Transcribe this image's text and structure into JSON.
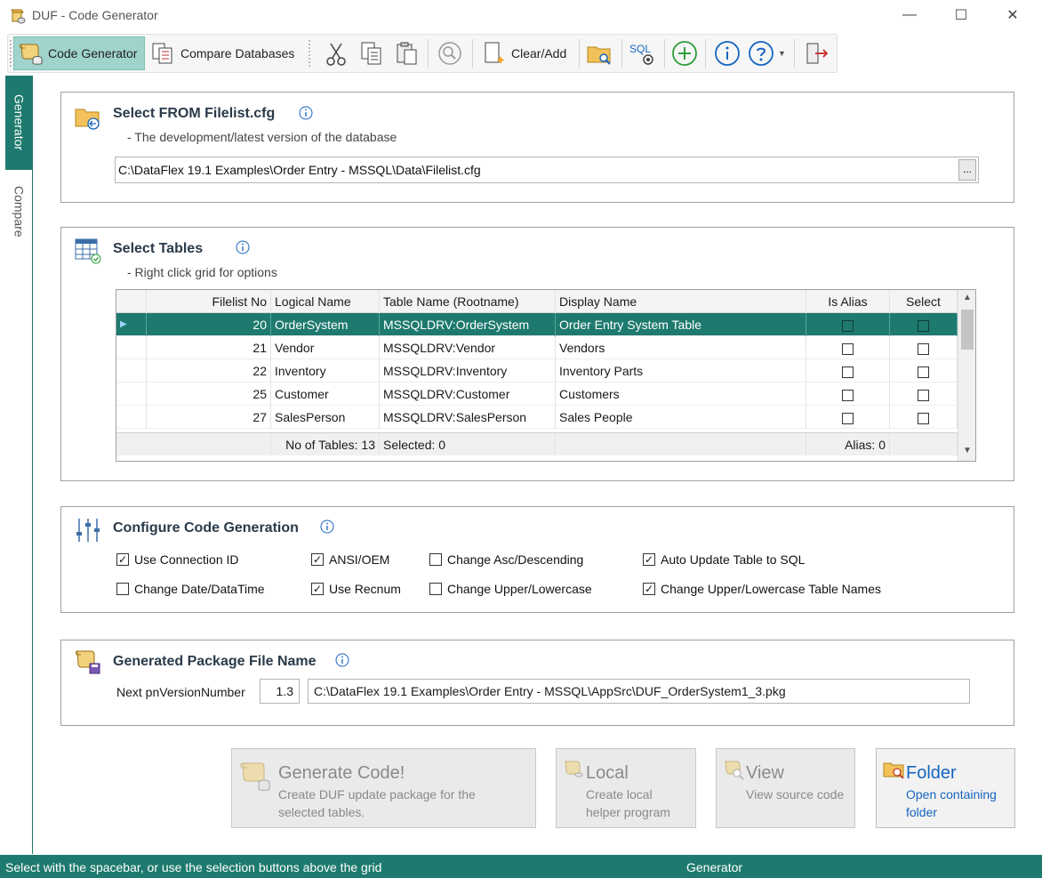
{
  "window": {
    "title": "DUF - Code Generator",
    "minimize": "—",
    "maximize": "☐",
    "close": "✕"
  },
  "toolbar": {
    "code_generator": "Code Generator",
    "compare_databases": "Compare Databases",
    "clear_add": "Clear/Add",
    "sql": "SQL"
  },
  "sidetabs": {
    "generator": "Generator",
    "compare": "Compare"
  },
  "select_from": {
    "title": "Select FROM Filelist.cfg",
    "subtitle": "- The development/latest version of the database",
    "path": "C:\\DataFlex 19.1 Examples\\Order Entry - MSSQL\\Data\\Filelist.cfg",
    "browse": "..."
  },
  "select_tables": {
    "title": "Select Tables",
    "subtitle": "- Right click grid for options",
    "columns": [
      "Filelist No",
      "Logical Name",
      "Table Name (Rootname)",
      "Display Name",
      "Is Alias",
      "Select"
    ],
    "rows": [
      {
        "no": "20",
        "logical": "OrderSystem",
        "table": "MSSQLDRV:OrderSystem",
        "display": "Order Entry System Table"
      },
      {
        "no": "21",
        "logical": "Vendor",
        "table": "MSSQLDRV:Vendor",
        "display": "Vendors"
      },
      {
        "no": "22",
        "logical": "Inventory",
        "table": "MSSQLDRV:Inventory",
        "display": "Inventory Parts"
      },
      {
        "no": "25",
        "logical": "Customer",
        "table": "MSSQLDRV:Customer",
        "display": "Customers"
      },
      {
        "no": "27",
        "logical": "SalesPerson",
        "table": "MSSQLDRV:SalesPerson",
        "display": "Sales People"
      }
    ],
    "footer": {
      "count": "No of Tables: 13",
      "selected": "Selected: 0",
      "alias": "Alias: 0"
    }
  },
  "configure": {
    "title": "Configure Code Generation",
    "options": [
      {
        "label": "Use Connection ID",
        "checked": true
      },
      {
        "label": "ANSI/OEM",
        "checked": true
      },
      {
        "label": "Change Asc/Descending",
        "checked": false
      },
      {
        "label": "Auto Update Table to SQL",
        "checked": true
      },
      {
        "label": "Change Date/DataTime",
        "checked": false
      },
      {
        "label": "Use Recnum",
        "checked": true
      },
      {
        "label": "Change Upper/Lowercase",
        "checked": false
      },
      {
        "label": "Change Upper/Lowercase Table Names",
        "checked": true
      }
    ]
  },
  "package": {
    "title": "Generated Package File Name",
    "version_label": "Next pnVersionNumber",
    "version_value": "1.3",
    "path": "C:\\DataFlex 19.1 Examples\\Order Entry - MSSQL\\AppSrc\\DUF_OrderSystem1_3.pkg"
  },
  "actions": {
    "generate": {
      "title": "Generate Code!",
      "desc1": "Create DUF update package for the",
      "desc2": "selected tables."
    },
    "local": {
      "title": "Local",
      "desc1": "Create local",
      "desc2": "helper program"
    },
    "view": {
      "title": "View",
      "desc1": "View source code",
      "desc2": ""
    },
    "folder": {
      "title": "Folder",
      "desc1": "Open containing",
      "desc2": "folder"
    }
  },
  "status": {
    "left": "Select with the spacebar, or use the selection buttons above the grid",
    "mid": "Generator"
  },
  "colors": {
    "accent": "#1e7a6e",
    "toolbar_active": "#9fd3cc",
    "link": "#1565c0"
  }
}
